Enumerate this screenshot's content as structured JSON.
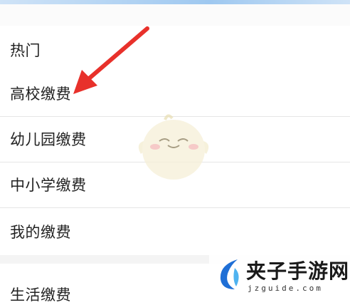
{
  "sections": {
    "hot": {
      "title": "热门",
      "items": [
        {
          "label": "高校缴费"
        },
        {
          "label": "幼儿园缴费"
        },
        {
          "label": "中小学缴费"
        },
        {
          "label": "我的缴费"
        }
      ]
    },
    "life": {
      "title": "生活缴费"
    }
  },
  "watermark": {
    "title": "夹子手游网",
    "url": "jzguide.com"
  },
  "colors": {
    "arrow": "#e8312b",
    "divider": "#e6e6e6",
    "top_bar": "#9ec8f0",
    "logo_blue": "#1f6fd6"
  }
}
